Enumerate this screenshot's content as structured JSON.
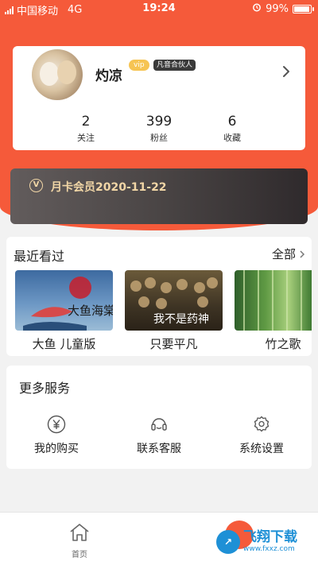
{
  "status_bar": {
    "carrier": "中国移动",
    "network": "4G",
    "time": "19:24",
    "battery": "99%",
    "battery_level": 0.99
  },
  "profile": {
    "username": "灼凉",
    "vip_label": "vip",
    "partner_label": "凡音合伙人",
    "stats": [
      {
        "value": "2",
        "label": "关注"
      },
      {
        "value": "399",
        "label": "粉丝"
      },
      {
        "value": "6",
        "label": "收藏"
      }
    ]
  },
  "membership": {
    "badge": "V",
    "text": "月卡会员2020-11-22"
  },
  "recent": {
    "title": "最近看过",
    "see_all": "全部",
    "items": [
      {
        "title": "大鱼 儿童版",
        "poster_text": "大鱼海棠"
      },
      {
        "title": "只要平凡",
        "poster_text": "我不是药神"
      },
      {
        "title": "竹之歌",
        "poster_text": ""
      }
    ]
  },
  "services": {
    "title": "更多服务",
    "items": [
      {
        "label": "我的购买",
        "icon": "yen-icon"
      },
      {
        "label": "联系客服",
        "icon": "headset-icon"
      },
      {
        "label": "系统设置",
        "icon": "gear-icon"
      }
    ]
  },
  "tabbar": {
    "home_label": "首页"
  },
  "watermark": {
    "text": "飞翔下载",
    "sub": "www.fxxz.com"
  },
  "colors": {
    "brand": "#f55a3a",
    "member_gold": "#f1d6a6",
    "vip_yellow": "#f6c453"
  }
}
